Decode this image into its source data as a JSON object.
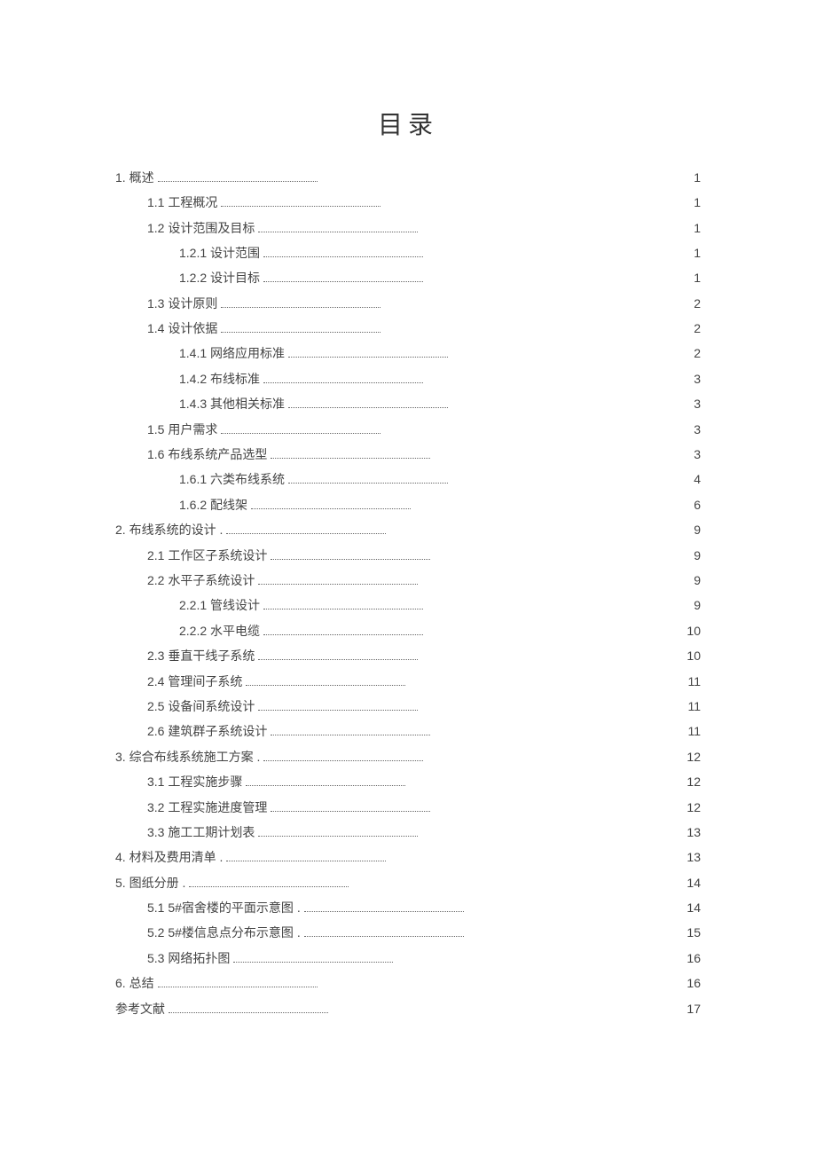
{
  "title": "目录",
  "toc": [
    {
      "label": "1. 概述",
      "page": "1",
      "level": 0
    },
    {
      "label": "1.1 工程概况",
      "page": "1",
      "level": 1
    },
    {
      "label": "1.2 设计范围及目标",
      "page": "1",
      "level": 1
    },
    {
      "label": "1.2.1 设计范围",
      "page": "1",
      "level": 2
    },
    {
      "label": "1.2.2 设计目标",
      "page": "1",
      "level": 2
    },
    {
      "label": "1.3 设计原则",
      "page": "2",
      "level": 1
    },
    {
      "label": "1.4 设计依据",
      "page": "2",
      "level": 1
    },
    {
      "label": "1.4.1 网络应用标准",
      "page": "2",
      "level": 2
    },
    {
      "label": "1.4.2 布线标准",
      "page": "3",
      "level": 2
    },
    {
      "label": "1.4.3 其他相关标准",
      "page": "3",
      "level": 2
    },
    {
      "label": "1.5 用户需求",
      "page": "3",
      "level": 1
    },
    {
      "label": "1.6 布线系统产品选型",
      "page": "3",
      "level": 1
    },
    {
      "label": "1.6.1 六类布线系统",
      "page": "4",
      "level": 2
    },
    {
      "label": "1.6.2 配线架",
      "page": "6",
      "level": 2
    },
    {
      "label": "2. 布线系统的设计 .",
      "page": "9",
      "level": 0
    },
    {
      "label": "2.1 工作区子系统设计",
      "page": "9",
      "level": 1
    },
    {
      "label": "2.2 水平子系统设计",
      "page": "9",
      "level": 1
    },
    {
      "label": "2.2.1 管线设计",
      "page": "9",
      "level": 2
    },
    {
      "label": "2.2.2 水平电缆",
      "page": "10",
      "level": 2
    },
    {
      "label": "2.3 垂直干线子系统",
      "page": "10",
      "level": 1
    },
    {
      "label": "2.4 管理间子系统",
      "page": "11",
      "level": 1
    },
    {
      "label": "2.5 设备间系统设计",
      "page": "11",
      "level": 1
    },
    {
      "label": "2.6 建筑群子系统设计",
      "page": "11",
      "level": 1
    },
    {
      "label": "3. 综合布线系统施工方案 .",
      "page": "12",
      "level": 0
    },
    {
      "label": "3.1 工程实施步骤",
      "page": "12",
      "level": 1
    },
    {
      "label": "3.2 工程实施进度管理",
      "page": "12",
      "level": 1
    },
    {
      "label": "3.3 施工工期计划表",
      "page": "13",
      "level": 1
    },
    {
      "label": "4. 材料及费用清单 .",
      "page": "13",
      "level": 0
    },
    {
      "label": "5. 图纸分册 .",
      "page": "14",
      "level": 0
    },
    {
      "label": "5.1 5#宿舍楼的平面示意图 .",
      "page": "14",
      "level": 1
    },
    {
      "label": "5.2 5#楼信息点分布示意图 .",
      "page": "15",
      "level": 1
    },
    {
      "label": "5.3 网络拓扑图",
      "page": "16",
      "level": 1
    },
    {
      "label": "6. 总结",
      "page": "16",
      "level": 0
    },
    {
      "label": "参考文献",
      "page": "17",
      "level": 0
    }
  ]
}
